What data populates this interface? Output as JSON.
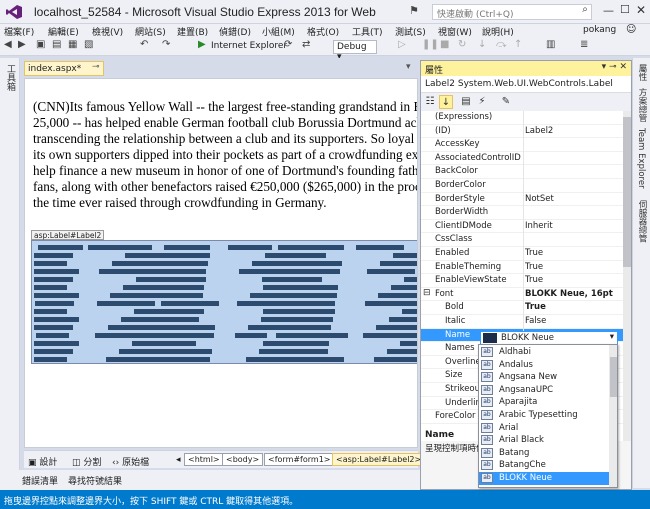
{
  "window": {
    "title": "localhost_52584 - Microsoft Visual Studio Express 2013 for Web",
    "quick_launch_placeholder": "快速啟動 (Ctrl+Q)"
  },
  "menu": [
    "檔案(F)",
    "編輯(E)",
    "檢視(V)",
    "網站(S)",
    "建置(B)",
    "偵錯(D)",
    "小組(M)",
    "格式(O)",
    "工具(T)",
    "測試(S)",
    "視窗(W)",
    "說明(H)"
  ],
  "user": {
    "name": "pokang"
  },
  "toolbar": {
    "run_label": "Internet Explorer",
    "config": "Debug"
  },
  "left_strip": {
    "toolbox": "工具箱"
  },
  "document": {
    "tab": "index.aspx*",
    "article": "(CNN)Its famous Yellow Wall -- the largest free-standing grandstand in Europe with a capacity of 25,000 -- has helped enable German football club Borussia Dortmund achieve the rare feat of transcending the relationship between a club and its supporters. So loyal is this club that 3,000 of its own supporters dipped into their pockets as part of a crowdfunding exercise, started in 2013, to help finance a new museum in honor of one of Dortmund's founding fathers. These Dortmund fans, along with other benefactors raised €250,000 ($265,000) in the process -- the biggest sum at the time ever raised through crowdfunding in Germany.",
    "label_tag": "asp:Label#Label2"
  },
  "design_bar": {
    "design": "設計",
    "split": "分割",
    "source": "原始檔",
    "crumbs": [
      "<html>",
      "<body>",
      "<form#form1>",
      "<asp:Label#Label2>"
    ]
  },
  "bottom_tabs": [
    "錯誤清單",
    "尋找符號結果"
  ],
  "status": "拖曳邊界控點來調整邊界大小，按下 SHIFT 鍵或 CTRL 鍵取得其他選項。",
  "properties": {
    "title": "屬性",
    "object": "Label2  System.Web.UI.WebControls.Label",
    "rows": [
      {
        "name": "(Expressions)",
        "value": ""
      },
      {
        "name": "(ID)",
        "value": "Label2"
      },
      {
        "name": "AccessKey",
        "value": ""
      },
      {
        "name": "AssociatedControlID",
        "value": ""
      },
      {
        "name": "BackColor",
        "value": ""
      },
      {
        "name": "BorderColor",
        "value": ""
      },
      {
        "name": "BorderStyle",
        "value": "NotSet"
      },
      {
        "name": "BorderWidth",
        "value": ""
      },
      {
        "name": "ClientIDMode",
        "value": "Inherit"
      },
      {
        "name": "CssClass",
        "value": ""
      },
      {
        "name": "Enabled",
        "value": "True"
      },
      {
        "name": "EnableTheming",
        "value": "True"
      },
      {
        "name": "EnableViewState",
        "value": "True"
      },
      {
        "name": "Font",
        "value": "BLOKK Neue, 16pt"
      },
      {
        "name": "Bold",
        "value": "True"
      },
      {
        "name": "Italic",
        "value": "False"
      },
      {
        "name": "Name",
        "value": "BLOKK Neue"
      },
      {
        "name": "Names",
        "value": ""
      },
      {
        "name": "Overline",
        "value": ""
      },
      {
        "name": "Size",
        "value": ""
      },
      {
        "name": "Strikeout",
        "value": ""
      },
      {
        "name": "Underline",
        "value": ""
      },
      {
        "name": "ForeColor",
        "value": ""
      }
    ],
    "desc_name": "Name",
    "desc_text": "呈現控制項時使"
  },
  "font_dropdown": {
    "items": [
      "Aldhabi",
      "Andalus",
      "Angsana New",
      "AngsanaUPC",
      "Aparajita",
      "Arabic Typesetting",
      "Arial",
      "Arial Black",
      "Batang",
      "BatangChe",
      "BLOKK Neue"
    ],
    "selected": "BLOKK Neue"
  },
  "right_strip": [
    "屬性",
    "方案總管",
    "Team Explorer",
    "伺服器總管"
  ]
}
